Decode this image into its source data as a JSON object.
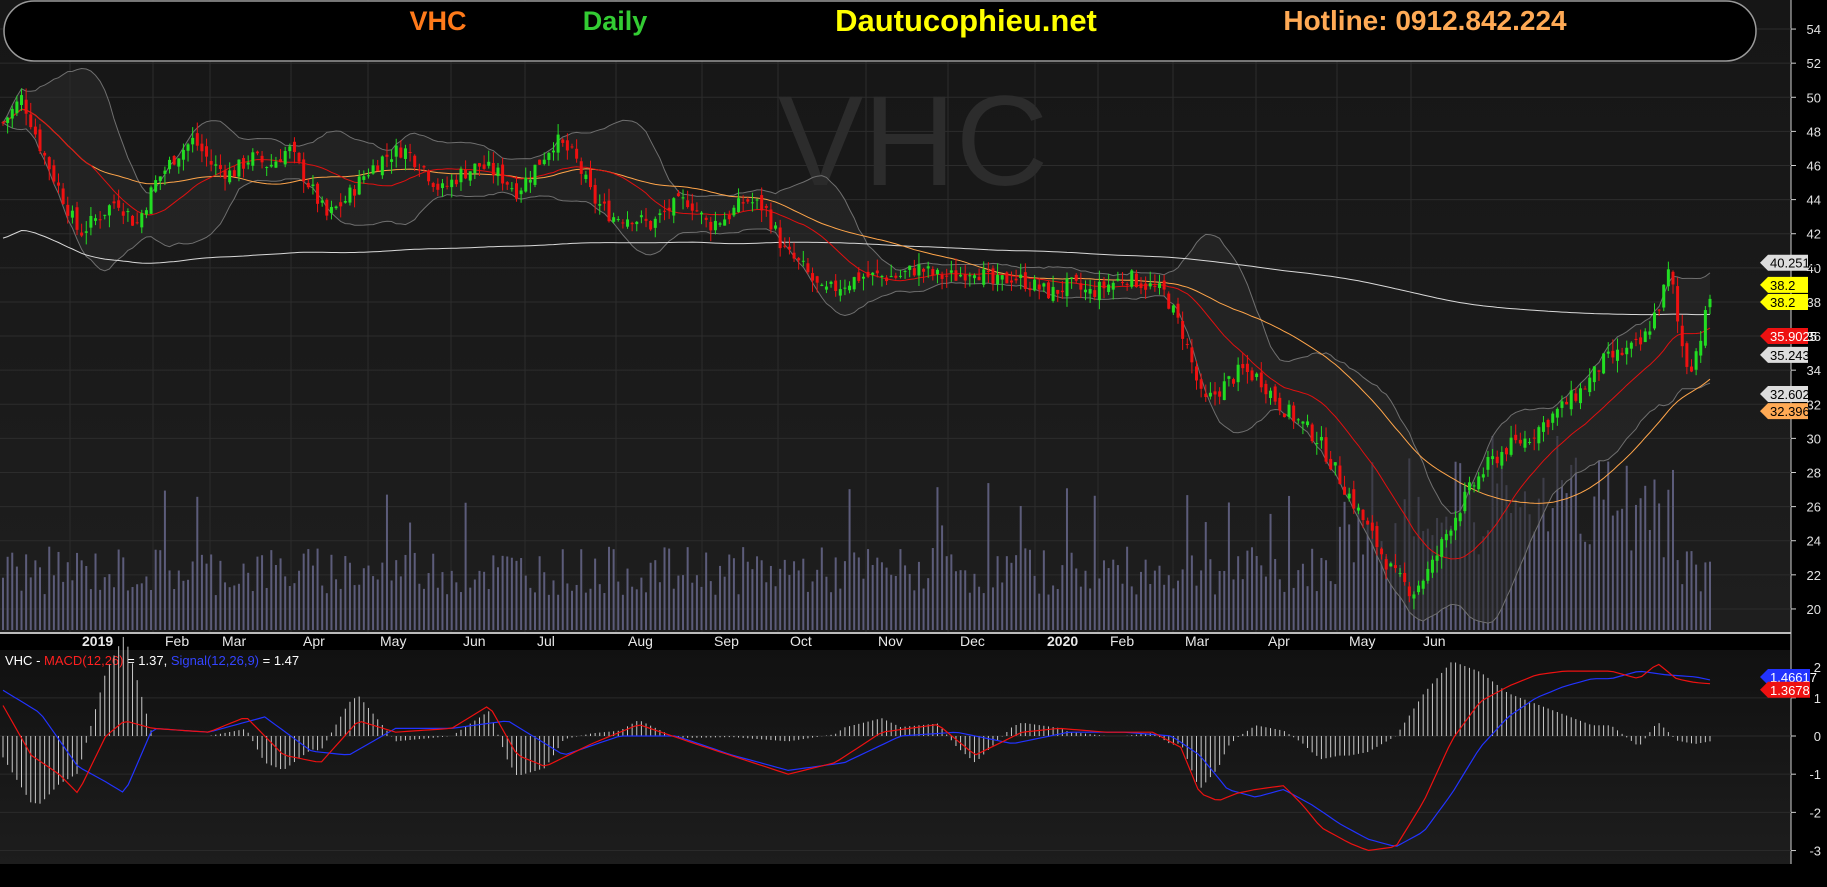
{
  "header": {
    "symbol": "VHC",
    "period": "Daily",
    "site": "Dautucophieu.net",
    "hotline": "Hotline: 0912.842.224",
    "symbol_color": "#ff7a1a",
    "period_color": "#33cc33",
    "site_color": "#ffff00",
    "hotline_color": "#ffaa55"
  },
  "watermark": "VHC",
  "chart_data": [
    {
      "type": "candlestick",
      "title": "VHC Daily",
      "ylim": [
        19,
        55
      ],
      "y_ticks": [
        20,
        22,
        24,
        26,
        28,
        30,
        32,
        34,
        36,
        38,
        40,
        42,
        44,
        46,
        48,
        50,
        52,
        54
      ],
      "x_labels": [
        {
          "label": "2019",
          "bold": true
        },
        {
          "label": "Feb"
        },
        {
          "label": "Mar"
        },
        {
          "label": "Apr"
        },
        {
          "label": "May"
        },
        {
          "label": "Jun"
        },
        {
          "label": "Jul"
        },
        {
          "label": "Aug"
        },
        {
          "label": "Sep"
        },
        {
          "label": "Oct"
        },
        {
          "label": "Nov"
        },
        {
          "label": "Dec"
        },
        {
          "label": "2020",
          "bold": true
        },
        {
          "label": "Feb"
        },
        {
          "label": "Mar"
        },
        {
          "label": "Apr"
        },
        {
          "label": "May"
        },
        {
          "label": "Jun"
        }
      ],
      "close_path": [
        [
          0,
          48.5
        ],
        [
          10,
          50
        ],
        [
          20,
          47
        ],
        [
          30,
          44.5
        ],
        [
          40,
          42
        ],
        [
          50,
          43
        ],
        [
          60,
          44
        ],
        [
          70,
          42.5
        ],
        [
          80,
          45
        ],
        [
          90,
          46.5
        ],
        [
          100,
          47.5
        ],
        [
          110,
          46
        ],
        [
          120,
          45.5
        ],
        [
          130,
          46.5
        ],
        [
          140,
          46
        ],
        [
          150,
          47
        ],
        [
          160,
          45
        ],
        [
          170,
          43
        ],
        [
          180,
          44
        ],
        [
          190,
          45.5
        ],
        [
          200,
          46.5
        ],
        [
          210,
          47
        ],
        [
          220,
          46
        ],
        [
          230,
          44.5
        ],
        [
          240,
          45.5
        ],
        [
          250,
          46
        ],
        [
          260,
          45.5
        ],
        [
          270,
          44.5
        ],
        [
          280,
          46
        ],
        [
          290,
          47.5
        ],
        [
          300,
          46.5
        ],
        [
          310,
          44
        ],
        [
          320,
          43
        ],
        [
          330,
          43
        ],
        [
          340,
          42.5
        ],
        [
          350,
          43.5
        ],
        [
          360,
          44
        ],
        [
          370,
          42.5
        ],
        [
          380,
          43
        ],
        [
          390,
          44
        ],
        [
          400,
          43.5
        ],
        [
          410,
          41
        ],
        [
          420,
          40
        ],
        [
          430,
          38.5
        ],
        [
          440,
          39
        ],
        [
          450,
          39.5
        ],
        [
          460,
          39.5
        ],
        [
          470,
          39.5
        ],
        [
          480,
          40
        ],
        [
          490,
          39.5
        ],
        [
          500,
          39.5
        ],
        [
          510,
          40
        ],
        [
          520,
          39
        ],
        [
          530,
          39.5
        ],
        [
          540,
          39
        ],
        [
          550,
          38.5
        ],
        [
          560,
          39
        ],
        [
          570,
          38.5
        ],
        [
          580,
          39
        ],
        [
          590,
          39.5
        ],
        [
          600,
          39
        ],
        [
          610,
          38.5
        ],
        [
          620,
          36
        ],
        [
          630,
          32
        ],
        [
          640,
          33
        ],
        [
          650,
          34
        ],
        [
          660,
          33.5
        ],
        [
          670,
          32
        ],
        [
          680,
          31
        ],
        [
          690,
          30
        ],
        [
          700,
          28
        ],
        [
          710,
          26
        ],
        [
          720,
          24
        ],
        [
          730,
          22
        ],
        [
          740,
          21
        ],
        [
          750,
          22.5
        ],
        [
          760,
          25
        ],
        [
          770,
          27
        ],
        [
          780,
          28.5
        ],
        [
          790,
          29.5
        ],
        [
          800,
          30
        ],
        [
          810,
          31
        ],
        [
          820,
          32
        ],
        [
          830,
          33
        ],
        [
          840,
          34.5
        ],
        [
          850,
          35
        ],
        [
          860,
          35.5
        ],
        [
          870,
          38
        ],
        [
          875,
          40
        ],
        [
          880,
          36
        ],
        [
          885,
          34
        ],
        [
          890,
          35.5
        ],
        [
          896,
          38.2
        ]
      ],
      "volume_max": 29,
      "indicator_labels": [
        {
          "text": "40.2513",
          "color": "#dddddd",
          "text_color": "#000000"
        },
        {
          "text": "38.2",
          "color": "#ffff00",
          "text_color": "#000000"
        },
        {
          "text": "38.2",
          "color": "#ffff00",
          "text_color": "#000000"
        },
        {
          "text": "35.9025",
          "color": "#ee1111",
          "text_color": "#ffffff"
        },
        {
          "text": "35.243",
          "color": "#dddddd",
          "text_color": "#000000"
        },
        {
          "text": "32.602",
          "color": "#dddddd",
          "text_color": "#000000"
        },
        {
          "text": "32.396",
          "color": "#ffaa55",
          "text_color": "#000000"
        }
      ],
      "indicator_values": [
        40.2513,
        38.2,
        38.2,
        35.9025,
        35.243,
        32.602,
        32.396
      ],
      "indicator_label_y": [
        40.3,
        39.0,
        38.0,
        36.0,
        34.9,
        32.6,
        31.6
      ]
    },
    {
      "type": "macd",
      "legend": {
        "symbol": "VHC",
        "dash": " - ",
        "macd_label": "MACD(12,26)",
        "macd_value": " = 1.37, ",
        "signal_label": "Signal(12,26,9)",
        "signal_value": " = 1.47"
      },
      "ylim": [
        -3.3,
        2.2
      ],
      "y_ticks": [
        -3,
        -2,
        -1,
        0,
        1
      ],
      "value_labels": [
        {
          "text": "1.46617",
          "color": "#2233ff",
          "value": 1.46617
        },
        {
          "text": "1.3678",
          "color": "#ee1111",
          "value": 1.3678
        }
      ],
      "macd_path": [
        [
          0,
          0.8
        ],
        [
          15,
          -0.5
        ],
        [
          30,
          -1.0
        ],
        [
          40,
          -1.5
        ],
        [
          55,
          0
        ],
        [
          65,
          0.4
        ],
        [
          80,
          0.2
        ],
        [
          110,
          0.1
        ],
        [
          130,
          0.5
        ],
        [
          150,
          -0.5
        ],
        [
          170,
          -0.7
        ],
        [
          190,
          0.4
        ],
        [
          210,
          0.1
        ],
        [
          240,
          0.2
        ],
        [
          260,
          0.8
        ],
        [
          275,
          -0.5
        ],
        [
          290,
          -0.8
        ],
        [
          315,
          -0.2
        ],
        [
          340,
          0.3
        ],
        [
          370,
          -0.2
        ],
        [
          395,
          -0.6
        ],
        [
          420,
          -1.0
        ],
        [
          445,
          -0.7
        ],
        [
          470,
          0.1
        ],
        [
          500,
          0.3
        ],
        [
          520,
          -0.5
        ],
        [
          545,
          0.1
        ],
        [
          565,
          0.2
        ],
        [
          590,
          0.1
        ],
        [
          615,
          0.1
        ],
        [
          630,
          -0.3
        ],
        [
          640,
          -1.5
        ],
        [
          650,
          -1.7
        ],
        [
          660,
          -1.5
        ],
        [
          670,
          -1.4
        ],
        [
          685,
          -1.3
        ],
        [
          695,
          -1.8
        ],
        [
          705,
          -2.4
        ],
        [
          720,
          -2.8
        ],
        [
          730,
          -3.0
        ],
        [
          745,
          -2.9
        ],
        [
          760,
          -1.7
        ],
        [
          775,
          -0.1
        ],
        [
          790,
          0.9
        ],
        [
          805,
          1.3
        ],
        [
          820,
          1.6
        ],
        [
          835,
          1.7
        ],
        [
          850,
          1.7
        ],
        [
          860,
          1.7
        ],
        [
          875,
          1.5
        ],
        [
          885,
          1.9
        ],
        [
          895,
          1.5
        ],
        [
          905,
          1.4
        ],
        [
          913,
          1.37
        ]
      ],
      "signal_path": [
        [
          0,
          1.2
        ],
        [
          20,
          0.6
        ],
        [
          40,
          -0.8
        ],
        [
          55,
          -1.2
        ],
        [
          65,
          -1.5
        ],
        [
          80,
          0.2
        ],
        [
          110,
          0.1
        ],
        [
          140,
          0.5
        ],
        [
          165,
          -0.4
        ],
        [
          185,
          -0.5
        ],
        [
          210,
          0.2
        ],
        [
          240,
          0.2
        ],
        [
          270,
          0.4
        ],
        [
          300,
          -0.5
        ],
        [
          330,
          0
        ],
        [
          360,
          0
        ],
        [
          390,
          -0.5
        ],
        [
          420,
          -0.9
        ],
        [
          450,
          -0.7
        ],
        [
          480,
          0
        ],
        [
          510,
          0.1
        ],
        [
          540,
          -0.2
        ],
        [
          570,
          0.1
        ],
        [
          600,
          0.1
        ],
        [
          625,
          0
        ],
        [
          640,
          -0.5
        ],
        [
          655,
          -1.4
        ],
        [
          670,
          -1.6
        ],
        [
          685,
          -1.4
        ],
        [
          700,
          -1.8
        ],
        [
          715,
          -2.3
        ],
        [
          730,
          -2.7
        ],
        [
          745,
          -2.9
        ],
        [
          760,
          -2.5
        ],
        [
          775,
          -1.5
        ],
        [
          790,
          -0.3
        ],
        [
          805,
          0.5
        ],
        [
          820,
          1.0
        ],
        [
          835,
          1.3
        ],
        [
          850,
          1.5
        ],
        [
          860,
          1.5
        ],
        [
          875,
          1.7
        ],
        [
          890,
          1.6
        ],
        [
          905,
          1.55
        ],
        [
          913,
          1.47
        ]
      ]
    }
  ]
}
